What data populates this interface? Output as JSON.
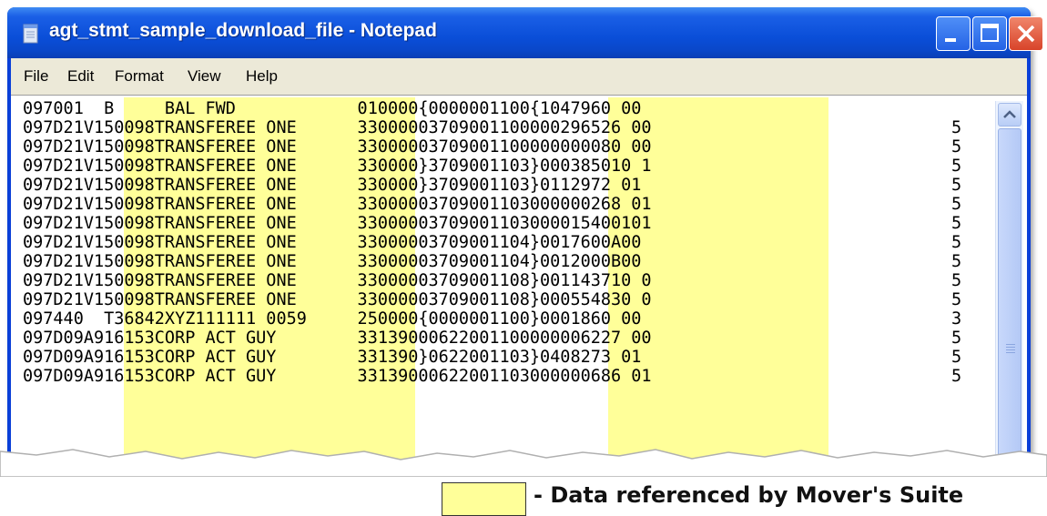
{
  "window": {
    "title": "agt_stmt_sample_download_file - Notepad",
    "icon": "notepad-icon",
    "colors": {
      "titlebar": "#0a4ed8",
      "close": "#d8442a",
      "highlight": "#ffff99"
    }
  },
  "menu": {
    "file": "File",
    "edit": "Edit",
    "format": "Format",
    "view": "View",
    "help": "Help"
  },
  "lines": [
    {
      "text": "097001  B     BAL FWD            010000{0000001100{1047960 00",
      "rc": ""
    },
    {
      "text": "097D21V150098TRANSFEREE ONE      33000003709001100000296526 00",
      "rc": "5"
    },
    {
      "text": "097D21V150098TRANSFEREE ONE      33000003709001100000000080 00",
      "rc": "5"
    },
    {
      "text": "097D21V150098TRANSFEREE ONE      330000}3709001103}000385010 1",
      "rc": "5"
    },
    {
      "text": "097D21V150098TRANSFEREE ONE      330000}3709001103}0112972 01",
      "rc": "5"
    },
    {
      "text": "097D21V150098TRANSFEREE ONE      33000003709001103000000268 01",
      "rc": "5"
    },
    {
      "text": "097D21V150098TRANSFEREE ONE      33000003709001103000015400101",
      "rc": "5"
    },
    {
      "text": "097D21V150098TRANSFEREE ONE      33000003709001104}0017600A00",
      "rc": "5"
    },
    {
      "text": "097D21V150098TRANSFEREE ONE      33000003709001104}0012000B00",
      "rc": "5"
    },
    {
      "text": "097D21V150098TRANSFEREE ONE      33000003709001108}001143710 0",
      "rc": "5"
    },
    {
      "text": "097D21V150098TRANSFEREE ONE      33000003709001108}000554830 0",
      "rc": "5"
    },
    {
      "text": "097440  T36842XYZ111111 0059     250000{0000001100}0001860 00",
      "rc": "3"
    },
    {
      "text": "097D09A916153CORP ACT GUY        33139000622001100000006227 00",
      "rc": "5"
    },
    {
      "text": "097D09A916153CORP ACT GUY        331390}0622001103}0408273 01",
      "rc": "5"
    },
    {
      "text": "097D09A916153CORP ACT GUY        33139000622001103000000686 01",
      "rc": "5"
    }
  ],
  "legend": {
    "text": "- Data referenced by Mover's Suite"
  }
}
